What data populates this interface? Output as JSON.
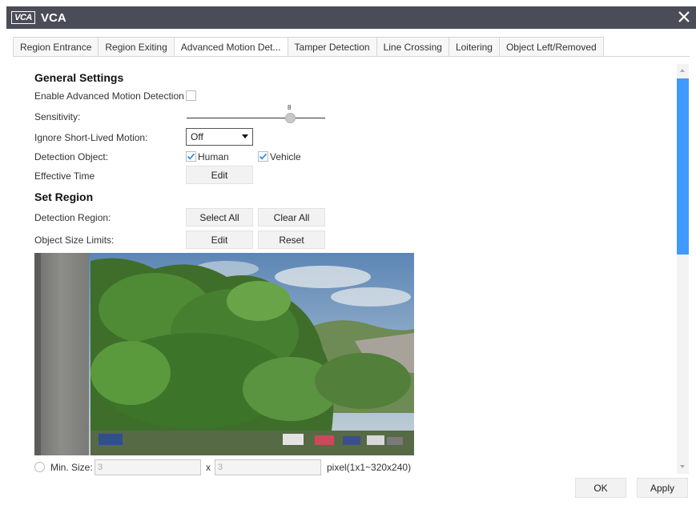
{
  "window": {
    "logo": "VCA",
    "title": "VCA",
    "close_icon": "close-icon"
  },
  "tabs": [
    {
      "label": "Region Entrance",
      "active": false
    },
    {
      "label": "Region Exiting",
      "active": false
    },
    {
      "label": "Advanced Motion Det...",
      "active": true
    },
    {
      "label": "Tamper Detection",
      "active": false
    },
    {
      "label": "Line Crossing",
      "active": false
    },
    {
      "label": "Loitering",
      "active": false
    },
    {
      "label": "Object Left/Removed",
      "active": false
    }
  ],
  "general": {
    "heading": "General Settings",
    "enable_label": "Enable Advanced Motion Detection",
    "enable_checked": false,
    "sensitivity_label": "Sensitivity:",
    "sensitivity_value": "8",
    "ignore_label": "Ignore Short-Lived Motion:",
    "ignore_value": "Off",
    "detection_object_label": "Detection Object:",
    "human_label": "Human",
    "human_checked": true,
    "vehicle_label": "Vehicle",
    "vehicle_checked": true,
    "effective_time_label": "Effective Time",
    "edit_label": "Edit"
  },
  "region": {
    "heading": "Set Region",
    "detection_region_label": "Detection Region:",
    "select_all_label": "Select All",
    "clear_all_label": "Clear All",
    "object_size_label": "Object Size Limits:",
    "edit_label": "Edit",
    "reset_label": "Reset"
  },
  "min_size": {
    "label": "Min. Size:",
    "width_placeholder": "3",
    "x_label": "x",
    "height_placeholder": "3",
    "range_label": "pixel(1x1~320x240)"
  },
  "footer": {
    "ok_label": "OK",
    "apply_label": "Apply"
  },
  "colors": {
    "titlebar": "#4a4d57",
    "accent": "#3f9aff",
    "check": "#2f8fe8"
  }
}
